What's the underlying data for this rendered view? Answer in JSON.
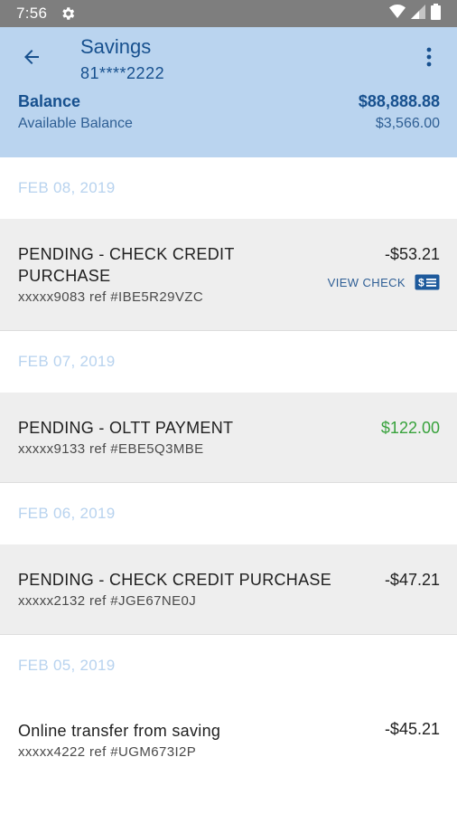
{
  "status_bar": {
    "time": "7:56"
  },
  "header": {
    "title": "Savings",
    "account_number": "81****2222",
    "balance_label": "Balance",
    "balance_value": "$88,888.88",
    "available_label": "Available Balance",
    "available_value": "$3,566.00"
  },
  "icons": {
    "back": "arrow-left-icon",
    "more": "more-vert-icon",
    "check": "check-icon",
    "settings": "gear-icon"
  },
  "colors": {
    "header_bg": "#bad4ef",
    "accent": "#17508e",
    "date_header": "#b8d3ef",
    "positive_amount": "#38a23c",
    "pending_row_bg": "#eeeeee"
  },
  "groups": [
    {
      "date": "FEB 08, 2019",
      "txn": {
        "desc_line1": "PENDING - CHECK CREDIT",
        "desc_line2": "PURCHASE",
        "ref": "xxxxx9083 ref #IBE5R29VZC",
        "amount": "-$53.21",
        "view_check": "VIEW CHECK"
      }
    },
    {
      "date": "FEB 07, 2019",
      "txn": {
        "desc": "PENDING - OLTT PAYMENT",
        "ref": "xxxxx9133 ref #EBE5Q3MBE",
        "amount": "$122.00"
      }
    },
    {
      "date": "FEB 06, 2019",
      "txn": {
        "desc": "PENDING - CHECK CREDIT PURCHASE",
        "ref": "xxxxx2132 ref #JGE67NE0J",
        "amount": "-$47.21"
      }
    },
    {
      "date": "FEB 05, 2019",
      "txn": {
        "desc": "Online transfer from saving",
        "ref": "xxxxx4222 ref #UGM673I2P",
        "amount": "-$45.21"
      }
    }
  ]
}
